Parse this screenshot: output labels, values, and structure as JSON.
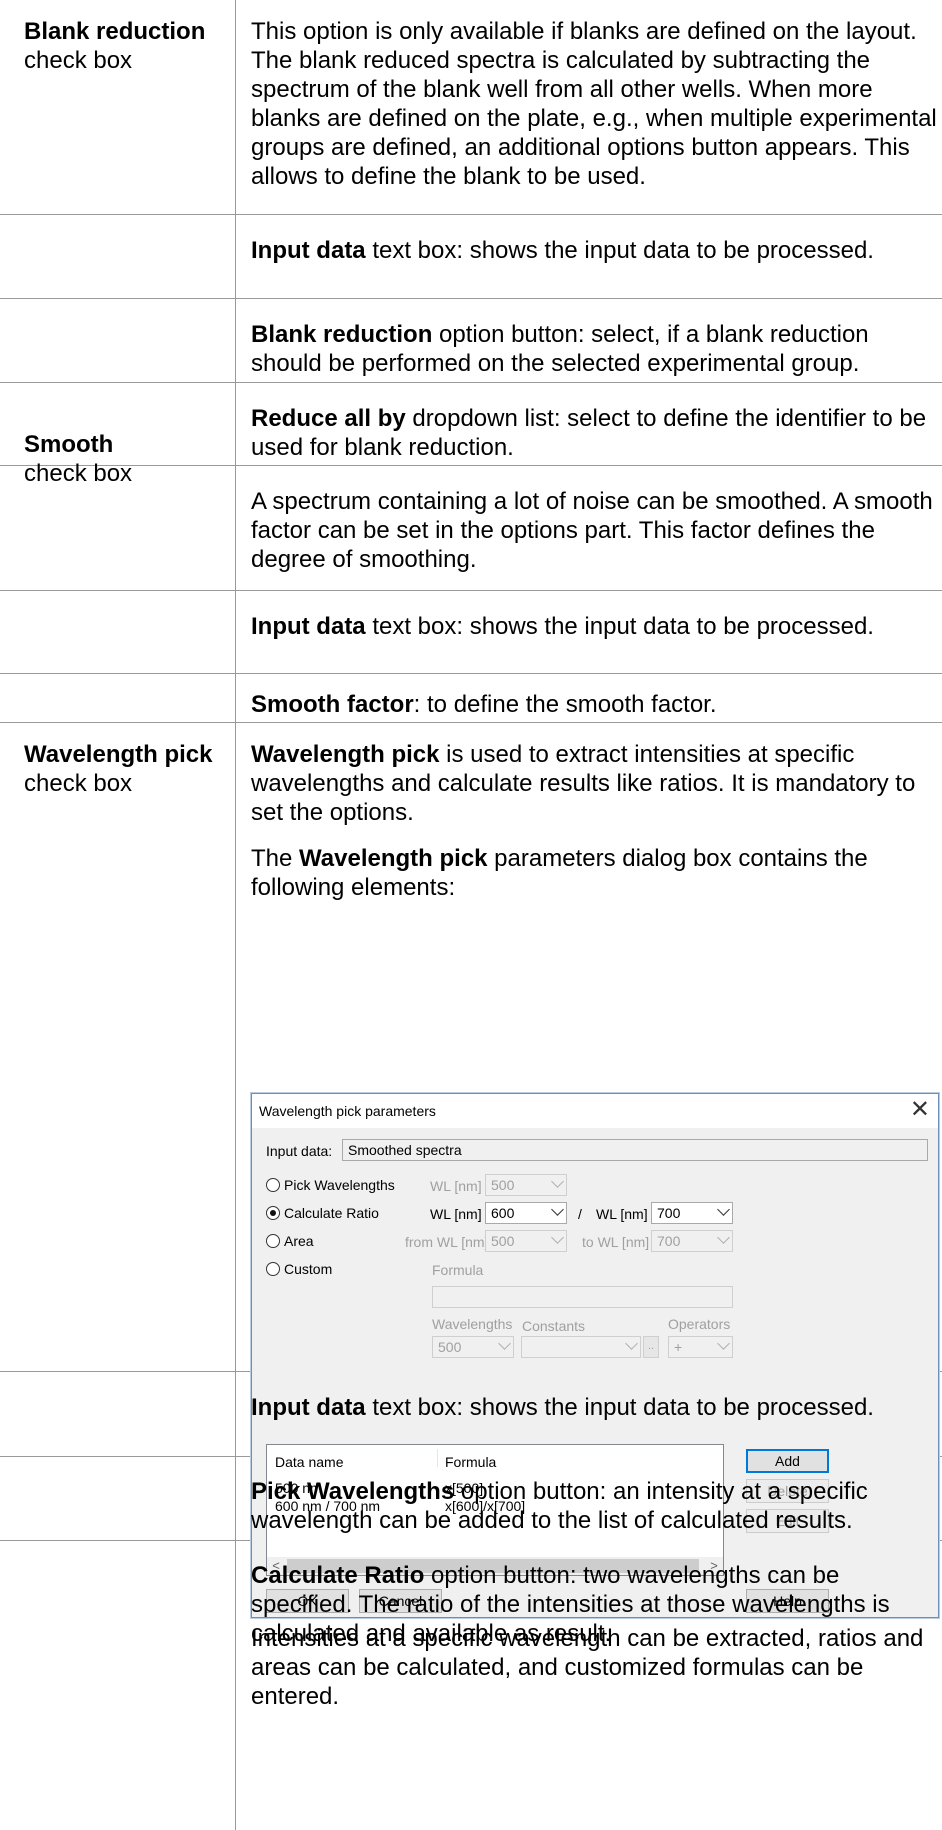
{
  "rows": [
    {
      "left_bold": "Blank reduction",
      "left_plain": "check box",
      "right": [
        {
          "text": "This option is only available if blanks are defined on the layout. The blank reduced spectra is calculated by subtracting the spectrum of the blank well from all other wells. When more blanks are defined on the plate, e.g., when multiple experimental groups are defined, an additional options button appears. This allows to define the blank to be used."
        }
      ]
    },
    {
      "right": [
        {
          "bold": "Input data",
          "text": " text box: shows the input data to be processed."
        }
      ]
    },
    {
      "right": [
        {
          "bold": "Blank reduction",
          "text": " option button: select, if a blank reduction should be performed on the selected experimental group."
        }
      ]
    },
    {
      "right": [
        {
          "bold": "Reduce all by",
          "text": " dropdown list: select to define the identifier to be used for blank reduction."
        }
      ]
    },
    {
      "left_bold": "Smooth",
      "left_plain": "check box",
      "right": [
        {
          "text": "A spectrum containing a lot of noise can be smoothed. A smooth factor can be set in the options part. This factor defines the degree of smoothing."
        }
      ]
    },
    {
      "right": [
        {
          "bold": "Input data",
          "text": " text box: shows the input data to be processed."
        }
      ]
    },
    {
      "right": [
        {
          "bold": "Smooth factor",
          "text": ": to define the smooth factor."
        }
      ]
    },
    {
      "left_bold": "Wavelength pick",
      "left_plain": "check box",
      "right": [
        {
          "bold": "Wavelength pick",
          "text": " is used to extract intensities at specific wavelengths and calculate results like ratios. It is mandatory to set the options."
        },
        {
          "pre": "The ",
          "bold": "Wavelength pick",
          "text": " parameters dialog box contains the following elements:"
        },
        {
          "text": "Intensities at a specific wavelength can be extracted, ratios and areas can be calculated, and customized formulas can be entered."
        }
      ]
    },
    {
      "right": [
        {
          "bold": "Input data",
          "text": " text box: shows the input data to be processed."
        }
      ]
    },
    {
      "right": [
        {
          "bold": "Pick Wavelengths",
          "text": " option button: an intensity at a specific wavelength can be added to the list of calculated results."
        }
      ]
    },
    {
      "right": [
        {
          "bold": "Calculate Ratio",
          "text": " option button: two wavelengths can be specified. The ratio of the intensities at those wavelengths is calculated and available as result."
        }
      ]
    }
  ],
  "dialog": {
    "title": "Wavelength pick parameters",
    "close_glyph": "✕",
    "input_label": "Input data:",
    "input_value": "Smoothed spectra",
    "options": [
      {
        "label": "Pick Wavelengths",
        "selected": false
      },
      {
        "label": "Calculate Ratio",
        "selected": true
      },
      {
        "label": "Area",
        "selected": false
      },
      {
        "label": "Custom",
        "selected": false
      }
    ],
    "pick": {
      "wl_label": "WL [nm]",
      "wl_value": "500"
    },
    "ratio": {
      "wl1_label": "WL [nm]",
      "wl1_value": "600",
      "slash": "/",
      "wl2_label": "WL [nm]",
      "wl2_value": "700"
    },
    "area": {
      "from_label": "from WL [nm]",
      "from_value": "500",
      "to_label": "to WL [nm]",
      "to_value": "700"
    },
    "custom": {
      "formula_label": "Formula",
      "formula_value": "",
      "wavelengths_label": "Wavelengths",
      "wavelengths_value": "500",
      "constants_label": "Constants",
      "constants_value": "",
      "more_glyph": "..",
      "operators_label": "Operators",
      "operators_value": "+"
    },
    "list": {
      "headers": [
        "Data name",
        "Formula"
      ],
      "rows": [
        [
          "500 nm",
          "x[500]"
        ],
        [
          "600 nm / 700 nm",
          "x[600]/x[700]"
        ]
      ],
      "scroll_left": "<",
      "scroll_right": ">"
    },
    "buttons": {
      "add": "Add",
      "delete": "Delete",
      "edit": "Edit",
      "ok": "OK",
      "cancel": "Cancel",
      "help": "Help"
    }
  }
}
